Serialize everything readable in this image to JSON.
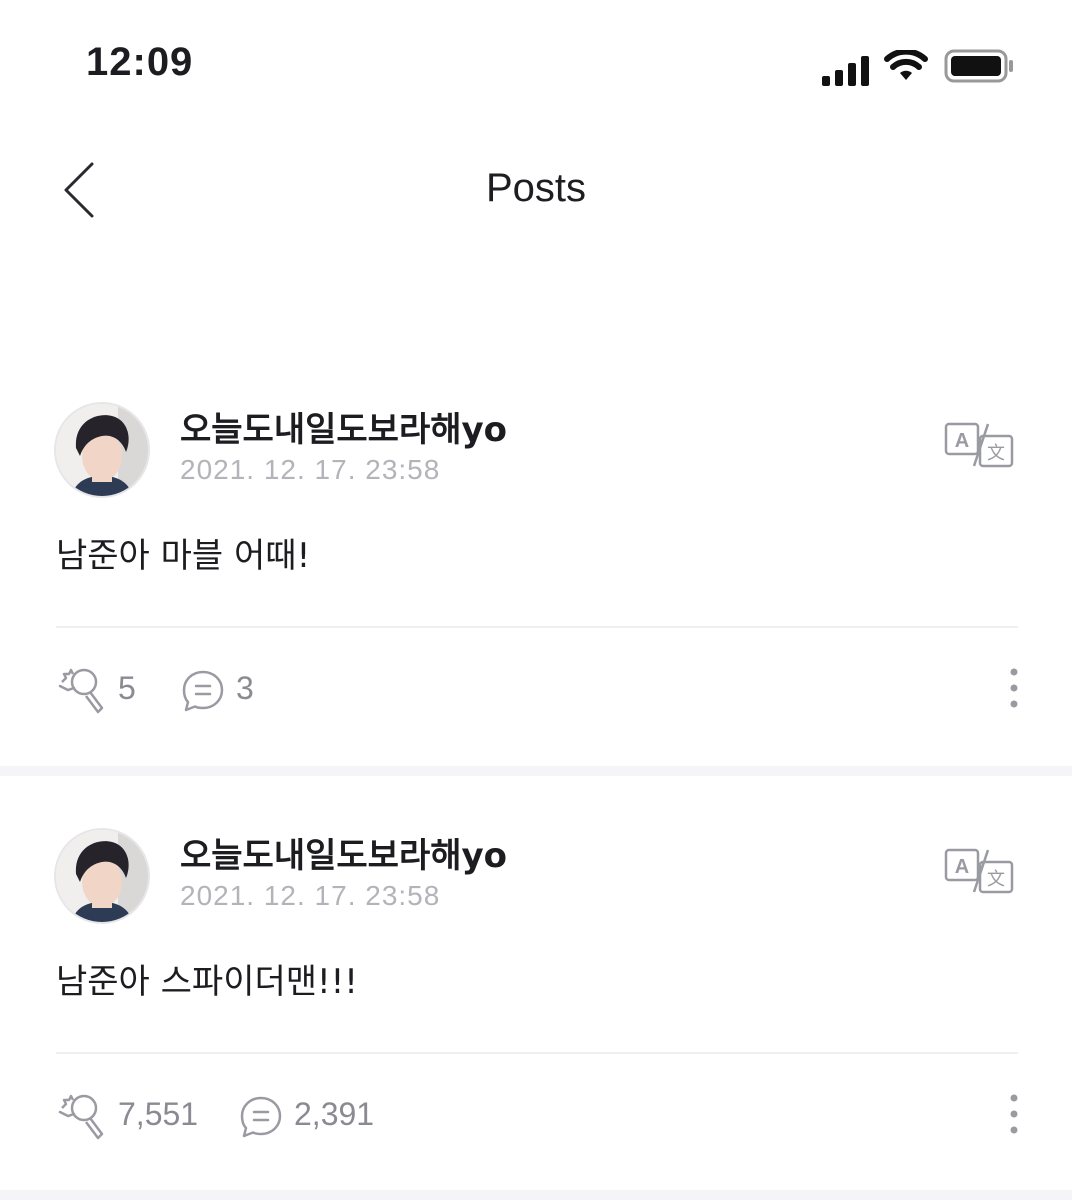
{
  "status_bar": {
    "time": "12:09",
    "icons": [
      "cellular-signal-icon",
      "wifi-icon",
      "battery-icon"
    ]
  },
  "header": {
    "title": "Posts",
    "back_icon": "chevron-left-icon"
  },
  "posts": [
    {
      "author": "오늘도내일도보라해yo",
      "date": "2021. 12. 17. 23:58",
      "body": "남준아 마블 어때!",
      "cheers": "5",
      "comments": "3"
    },
    {
      "author": "오늘도내일도보라해yo",
      "date": "2021. 12. 17. 23:58",
      "body": "남준아 스파이더맨!!!",
      "cheers": "7,551",
      "comments": "2,391"
    }
  ],
  "colors": {
    "text_primary": "#1d1d21",
    "text_secondary": "#b3b3b9",
    "icon_gray": "#8a8a92",
    "separator": "#f5f5f8"
  }
}
